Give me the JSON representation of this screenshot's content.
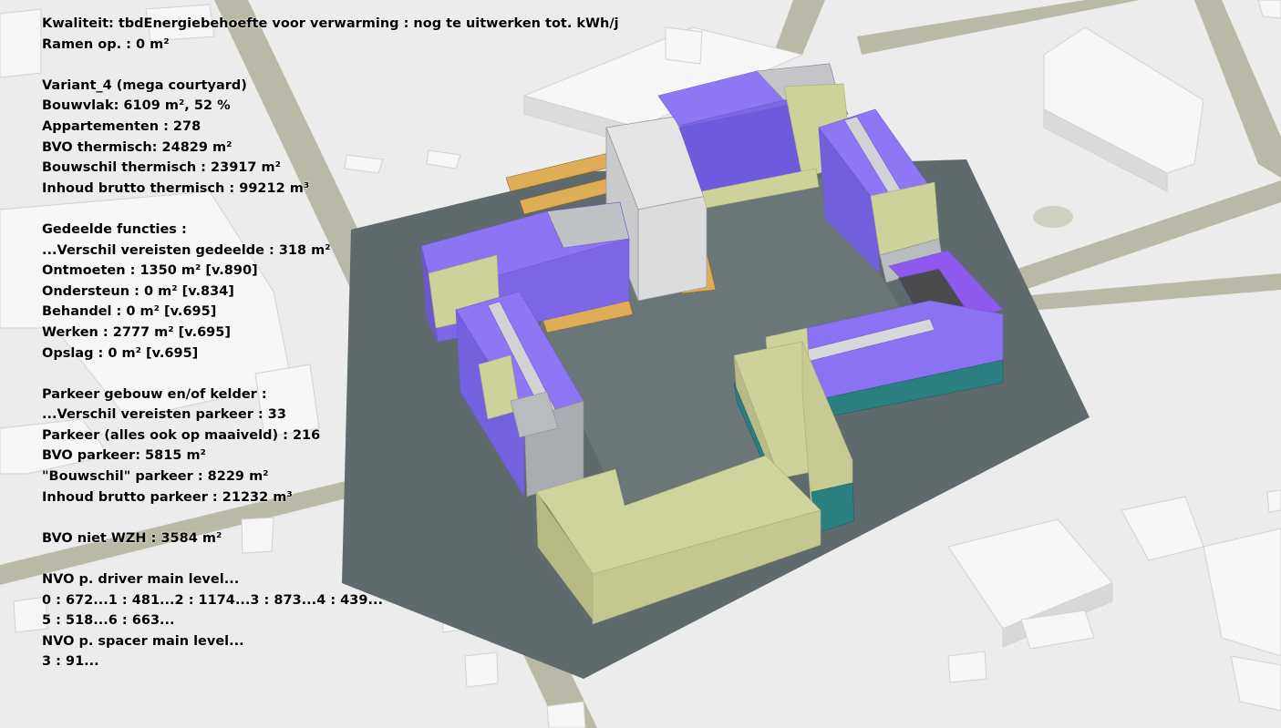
{
  "overlay": {
    "kwaliteit": "Kwaliteit: tbdEnergiebehoefte voor verwarming : nog te uitwerken tot. kWh/j",
    "ramen": "Ramen op. : 0 m²",
    "variant": "Variant_4 (mega courtyard)",
    "bouwvlak": "Bouwvlak: 6109 m²,  52 %",
    "appartementen": "Appartementen : 278",
    "bvo_thermisch": "BVO thermisch: 24829 m²",
    "bouwschil_thermisch": "Bouwschil thermisch : 23917 m²",
    "inhoud_thermisch": "Inhoud brutto thermisch : 99212 m³",
    "gedeelde_functies": "Gedeelde functies :",
    "verschil_gedeelde": "...Verschil vereisten gedeelde : 318 m²",
    "ontmoeten": "Ontmoeten : 1350 m²  [v.890]",
    "ondersteun": "Ondersteun : 0 m²  [v.834]",
    "behandel": "Behandel : 0 m²  [v.695]",
    "werken": "Werken : 2777 m²  [v.695]",
    "opslag": "Opslag : 0 m²  [v.695]",
    "parkeer_header": "Parkeer gebouw en/of kelder :",
    "verschil_parkeer": "...Verschil vereisten parkeer : 33",
    "parkeer_alles": "Parkeer (alles ook op maaiveld) : 216",
    "bvo_parkeer": "BVO parkeer: 5815 m²",
    "bouwschil_parkeer": "\"Bouwschil\" parkeer : 8229 m²",
    "inhoud_parkeer": "Inhoud brutto parkeer : 21232 m³",
    "bvo_niet_wzh": "BVO niet WZH : 3584 m²",
    "nvo_driver_header": "NVO p. driver main level...",
    "nvo_driver_1": "0 : 672...1 : 481...2 : 1174...3 : 873...4 : 439...",
    "nvo_driver_2": "5 : 518...6 : 663...",
    "nvo_spacer_header": "NVO p. spacer main level...",
    "nvo_spacer_1": "3 : 91..."
  },
  "colors": {
    "ground": "#ececec",
    "road": "#b9b8a6",
    "plot": "#5e6a6c",
    "courtyard": "#6a7576",
    "purple": "#8a72f2",
    "olive": "#cdd19a",
    "grey_block": "#b9bcbf",
    "teal": "#2c7f80",
    "parking_yellow": "#e4b25a"
  }
}
